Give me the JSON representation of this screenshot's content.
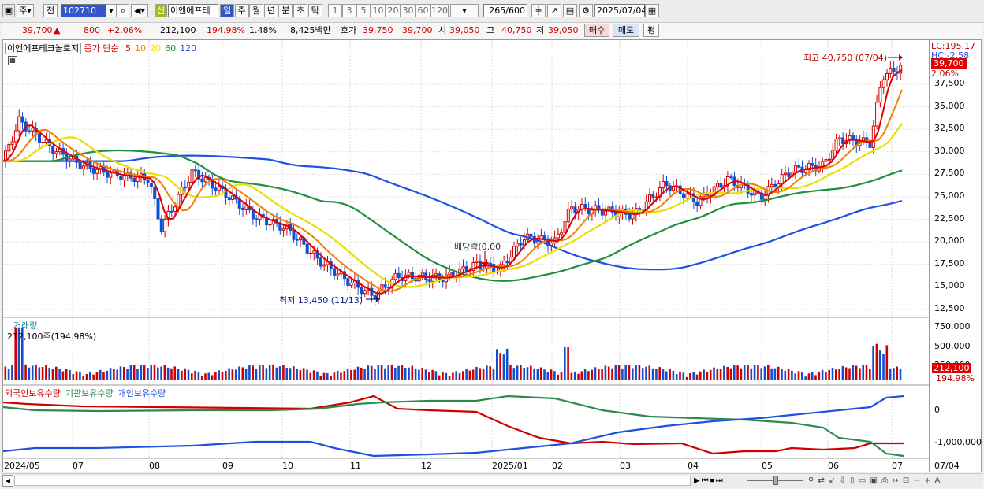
{
  "toolbar": {
    "period_label": "주",
    "prev_label": "전",
    "code_value": "102710",
    "name_badge": "신",
    "name_value": "이엔에프테",
    "tabs": [
      "일",
      "주",
      "월",
      "년",
      "분",
      "초",
      "틱"
    ],
    "active_tab": 0,
    "intervals": [
      "1",
      "3",
      "5",
      "10",
      "20",
      "30",
      "60",
      "120"
    ],
    "count_label": "265/600",
    "date_value": "2025/07/04"
  },
  "info": {
    "price": "39,700",
    "change_arrow": "▲",
    "change": "800",
    "change_pct": "+2.06%",
    "volume": "212,100",
    "volume_pct": "194.98%",
    "turnover_pct": "1.48%",
    "amount": "8,425백만",
    "quote_label": "호가",
    "quote_bid": "39,750",
    "quote_ask": "39,700",
    "open_label": "시",
    "open": "39,050",
    "high_label": "고",
    "high": "40,750",
    "low_label": "저",
    "low": "39,050",
    "buy_label": "매수",
    "sell_label": "매도",
    "eval_label": "평"
  },
  "legend": {
    "stock_name": "이엔에프테크놀로지",
    "ma_label": "종가 단순",
    "ma": [
      {
        "period": "5",
        "color": "#e00000"
      },
      {
        "period": "10",
        "color": "#f08000"
      },
      {
        "period": "20",
        "color": "#e8e000"
      },
      {
        "period": "60",
        "color": "#209040"
      },
      {
        "period": "120",
        "color": "#2050e0"
      }
    ]
  },
  "annotations": {
    "high": "최고 40,750 (07/04)",
    "low": "최저 13,450 (11/13)",
    "dividend": "배당락(0.00"
  },
  "axis": {
    "lc": "LC:195.17",
    "hc": "HC:-2.58",
    "current": "39,700",
    "current_pct": "2.06%",
    "price_ticks": [
      "37,500",
      "35,000",
      "32,500",
      "30,000",
      "27,500",
      "25,000",
      "22,500",
      "20,000",
      "17,500",
      "15,000",
      "12,500"
    ],
    "volume_ticks": [
      "750,000",
      "500,000",
      "250,000"
    ],
    "volume_current": "212,100",
    "volume_current_pct": "194.98%",
    "holding_ticks": [
      "0",
      "-1,000,000"
    ]
  },
  "volume_panel": {
    "title": "거래량",
    "value": "212,100주(194.98%)"
  },
  "holding_panel": {
    "items": [
      {
        "label": "외국인보유수량",
        "color": "#d00000"
      },
      {
        "label": "기관보유수량",
        "color": "#2a8a50"
      },
      {
        "label": "개인보유수량",
        "color": "#2050e0"
      }
    ]
  },
  "x_axis": [
    "2024/05",
    "07",
    "08",
    "09",
    "10",
    "11",
    "12",
    "2025/01",
    "02",
    "03",
    "04",
    "05",
    "06",
    "07"
  ],
  "x_axis_right": "07/04",
  "colors": {
    "up": "#d00000",
    "down": "#1050d0"
  }
}
